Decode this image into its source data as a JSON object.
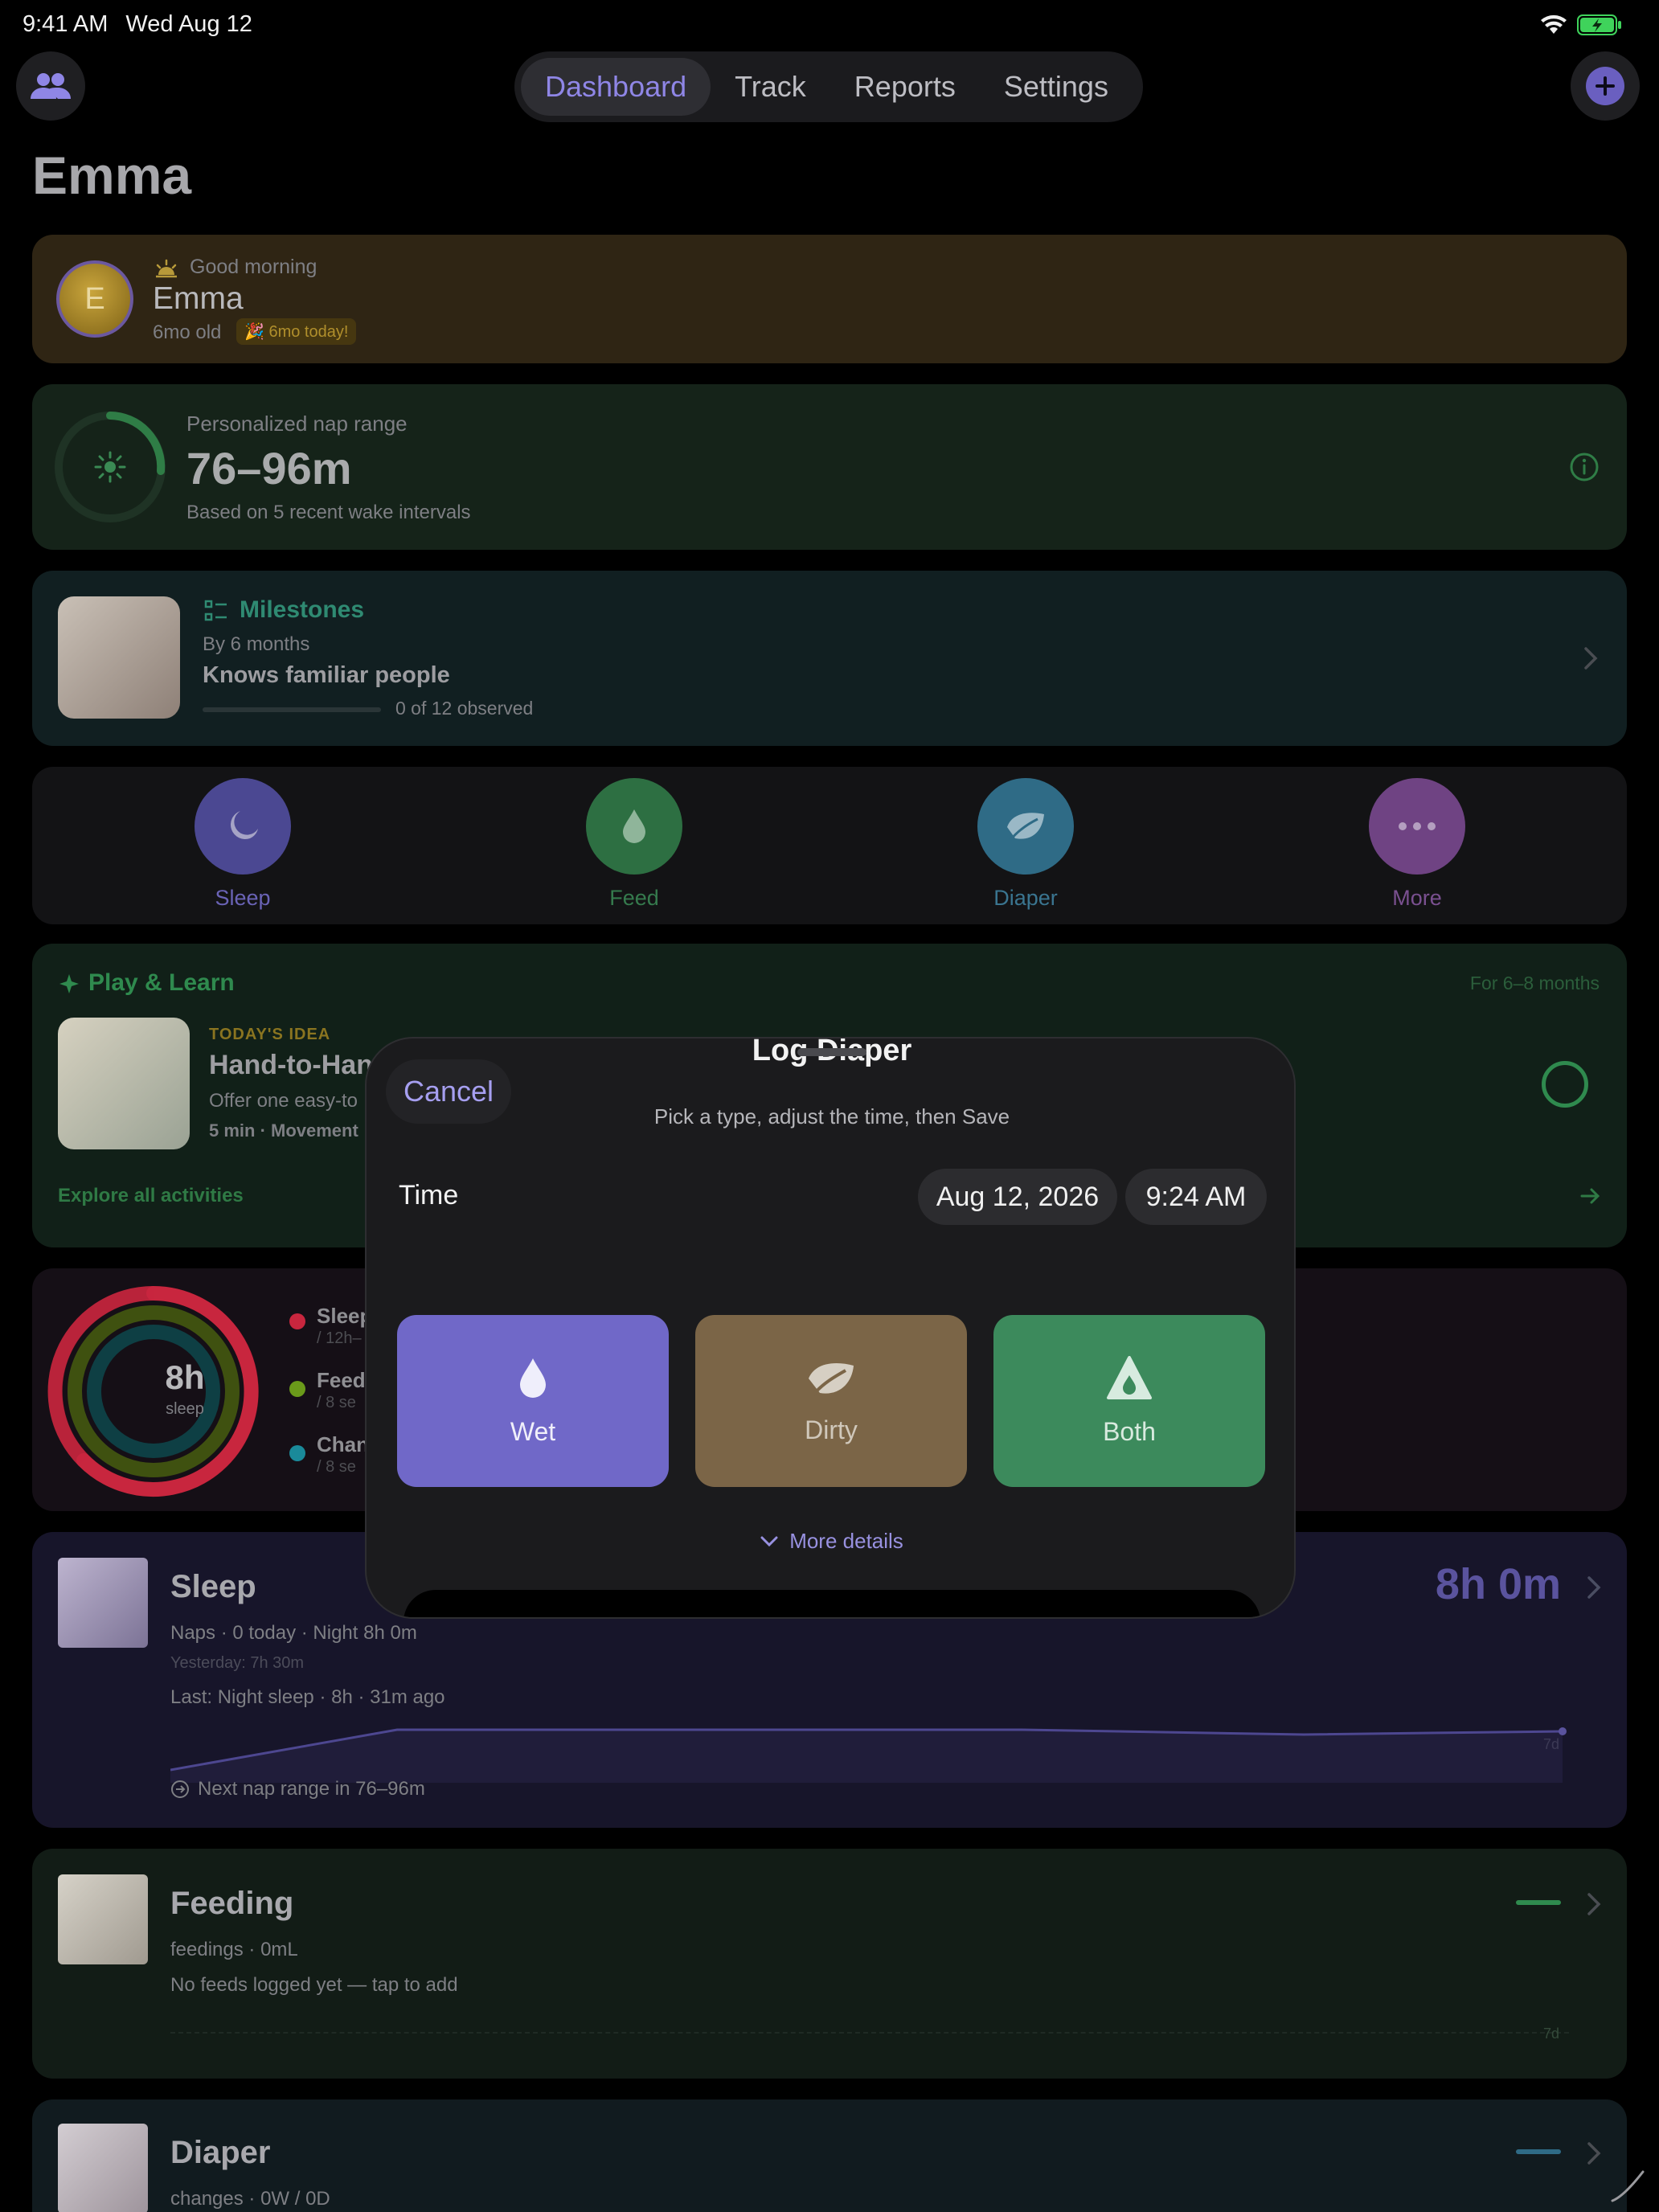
{
  "status": {
    "time": "9:41 AM",
    "date": "Wed Aug 12"
  },
  "nav": {
    "tabs": [
      "Dashboard",
      "Track",
      "Reports",
      "Settings"
    ]
  },
  "page_title": "Emma",
  "greeting": {
    "salutation": "Good morning",
    "name": "Emma",
    "initial": "E",
    "age": "6mo old",
    "badge": "🎉 6mo today!"
  },
  "nap": {
    "label": "Personalized nap range",
    "range": "76–96m",
    "note": "Based on 5 recent wake intervals"
  },
  "milestones": {
    "title": "Milestones",
    "period": "By 6 months",
    "item": "Knows familiar people",
    "progress_text": "0 of 12 observed",
    "progress": 0
  },
  "quick": {
    "sleep": "Sleep",
    "feed": "Feed",
    "diaper": "Diaper",
    "more": "More"
  },
  "play": {
    "title": "Play & Learn",
    "age": "For 6–8 months",
    "tag": "TODAY'S IDEA",
    "name": "Hand-to-Hand",
    "desc": "Offer one easy-to",
    "meta": "5 min · Movement",
    "explore": "Explore all activities"
  },
  "rings": {
    "value": "8h",
    "unit": "sleep",
    "items": [
      {
        "name": "Sleep",
        "sub": "/ 12h–"
      },
      {
        "name": "Feed",
        "sub": "/ 8 se"
      },
      {
        "name": "Change",
        "sub": "/ 8 se"
      }
    ]
  },
  "sleep": {
    "title": "Sleep",
    "value": "8h 0m",
    "line1": "Naps · 0 today · Night 8h 0m",
    "line2": "Yesterday: 7h 30m",
    "line3": "Last: Night sleep · 8h · 31m ago",
    "next": "Next nap range in 76–96m",
    "axis": "7d"
  },
  "feeding": {
    "title": "Feeding",
    "line1": "feedings · 0mL",
    "line2": "No feeds logged yet — tap to add",
    "axis": "7d"
  },
  "diaper": {
    "title": "Diaper",
    "line1": "changes · 0W / 0D"
  },
  "modal": {
    "title": "Log Diaper",
    "cancel": "Cancel",
    "subtitle": "Pick a type, adjust the time, then Save",
    "time_label": "Time",
    "date": "Aug 12, 2026",
    "time": "9:24 AM",
    "types": [
      "Wet",
      "Dirty",
      "Both"
    ],
    "more": "More details"
  },
  "colors": {
    "accent": "#8f86e6",
    "wet": "#7068c8",
    "dirty": "#7b6547",
    "both": "#3c8a5c"
  }
}
